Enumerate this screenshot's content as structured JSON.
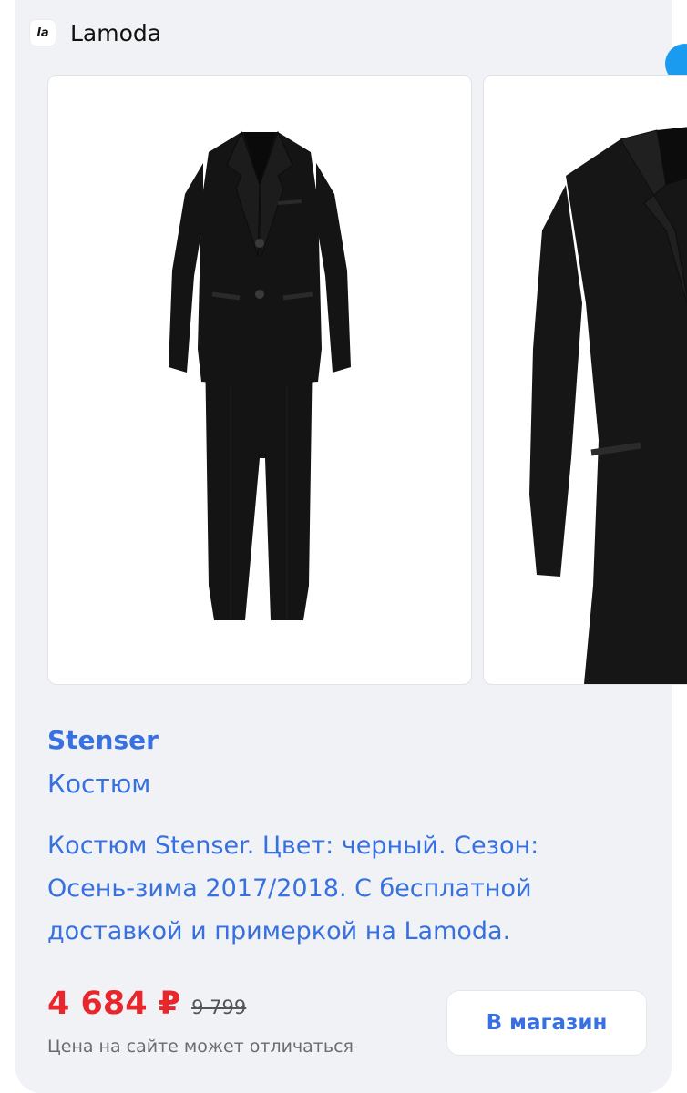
{
  "header": {
    "logo_text": "la",
    "shop_name": "Lamoda"
  },
  "gallery": {
    "images": [
      {
        "icon": "suit-full-image"
      },
      {
        "icon": "suit-jacket-closeup-image"
      }
    ]
  },
  "product": {
    "brand": "Stenser",
    "type": "Костюм",
    "description": "Костюм Stenser. Цвет: черный. Сезон: Осень-зима 2017/2018. С бесплатной доставкой и примеркой на Lamoda."
  },
  "pricing": {
    "price": "4 684 ₽",
    "old_price": "9 799",
    "note": "Цена на сайте может отличаться"
  },
  "actions": {
    "shop_button": "В магазин"
  },
  "colors": {
    "link_blue": "#3770e0",
    "price_red": "#e8262c",
    "card_bg": "#f1f2f6"
  }
}
